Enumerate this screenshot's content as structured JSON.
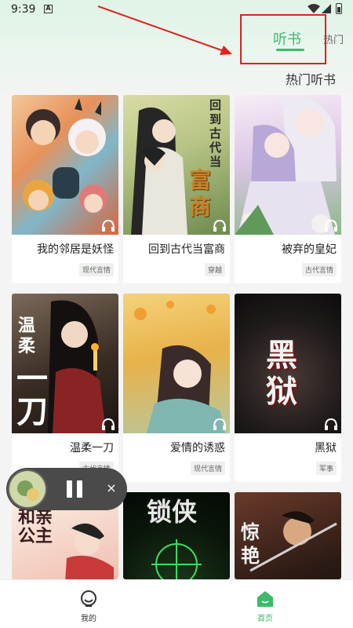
{
  "status_bar": {
    "time": "9:39",
    "notif_letter": "A"
  },
  "header": {
    "tabs": [
      {
        "label": "听书",
        "active": true
      },
      {
        "label": "热门",
        "active": false
      }
    ],
    "section_title": "热门听书",
    "accent_color": "#3fb96b"
  },
  "books": [
    {
      "title": "我的邻居是妖怪",
      "tag": "现代言情"
    },
    {
      "title": "回到古代当富商",
      "tag": "穿越",
      "cover_text": [
        "回",
        "到",
        "古",
        "代",
        "当"
      ],
      "cover_big": "富商"
    },
    {
      "title": "被弃的皇妃",
      "tag": "古代言情"
    },
    {
      "title": "温柔一刀",
      "tag": "古代言情",
      "cover_text": "温柔",
      "cover_big": "一刀"
    },
    {
      "title": "爱情的诱惑",
      "tag": "现代言情"
    },
    {
      "title": "黑狱",
      "tag": "军事",
      "cover_text": "黑狱"
    },
    {
      "title": "",
      "cover_text": "和亲公主"
    },
    {
      "title": "",
      "cover_text": "锁侠"
    },
    {
      "title": "",
      "cover_text": "惊艳"
    }
  ],
  "mini_player": {
    "close_glyph": "×"
  },
  "bottom_nav": [
    {
      "label": "我的",
      "icon": "smiley-icon",
      "active": false
    },
    {
      "label": "首页",
      "icon": "home-icon",
      "active": true
    }
  ]
}
